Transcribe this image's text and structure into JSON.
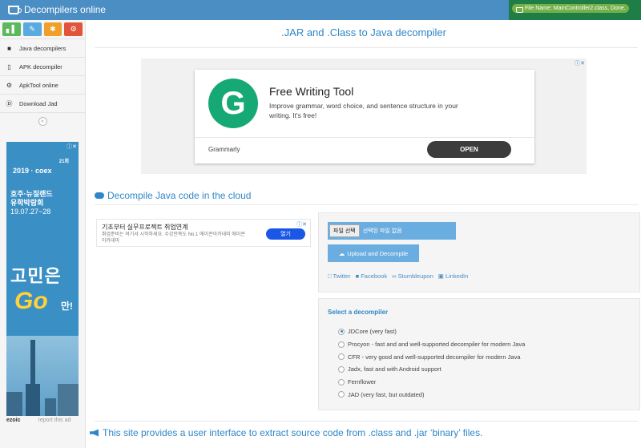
{
  "header": {
    "brand": "Decompilers online",
    "file_status": "File Name: MainController2.class, Done."
  },
  "sidebar": {
    "shortcuts": [
      {
        "icon": "signal-icon",
        "glyph": "▖▌",
        "color": "#5cb85c"
      },
      {
        "icon": "pencil-icon",
        "glyph": "✎",
        "color": "#5aaae0"
      },
      {
        "icon": "users-icon",
        "glyph": "✱",
        "color": "#f0a02a"
      },
      {
        "icon": "cogs-icon",
        "glyph": "⚙",
        "color": "#e2543a"
      }
    ],
    "items": [
      {
        "label": "Java decompilers",
        "icon": "coffee-icon",
        "glyph": "■"
      },
      {
        "label": "APK decompiler",
        "icon": "mobile-icon",
        "glyph": "▯"
      },
      {
        "label": "ApkTool online",
        "icon": "gear-icon",
        "glyph": "⚙"
      },
      {
        "label": "Download Jad",
        "icon": "download-icon",
        "glyph": "Ⓓ"
      }
    ],
    "collapse_glyph": "«",
    "ad": {
      "line1": "2019 · coex",
      "line2": "호주·뉴질랜드",
      "line3": "유학박람회",
      "date": "19.07.27~28",
      "big": "고민은",
      "go": "Go",
      "man": "만!",
      "small": "21회"
    },
    "ezoic": "ezoic",
    "report": "report this ad"
  },
  "main": {
    "title": ".JAR and .Class to Java decompiler",
    "top_ad": {
      "headline": "Free Writing Tool",
      "description": "Improve grammar, word choice, and sentence structure in your writing. It's free!",
      "advertiser": "Grammarly",
      "cta": "OPEN",
      "logo_letter": "G"
    },
    "section_title": "Decompile Java code in the cloud",
    "small_ad": {
      "line1": "기초부터 실무프로젝트 취업연계",
      "line2": "취업준비는 여기서 시작하세요. 수강만족도 No.1 에이콘아카데미 에이콘 아카데미",
      "button": "열기"
    },
    "file_button": "파일 선택",
    "file_text": "선택된 파일 없음",
    "upload_button": "Upload and Decompile",
    "share_links": [
      "Twitter",
      "Facebook",
      "Stumbleupon",
      "LinkedIn"
    ],
    "decompiler_heading": "Select a decompiler",
    "decompilers": [
      {
        "label": "JDCore (very fast)",
        "selected": true
      },
      {
        "label": "Procyon - fast and and well-supported decompiler for modern Java",
        "selected": false
      },
      {
        "label": "CFR - very good and well-supported decompiler for modern Java",
        "selected": false
      },
      {
        "label": "Jadx, fast and with Android support",
        "selected": false
      },
      {
        "label": "Fernflower",
        "selected": false
      },
      {
        "label": "JAD (very fast, but outdated)",
        "selected": false
      }
    ],
    "footer_text": "This site provides a user interface to extract source code from .class and .jar ‘binary’ files."
  }
}
